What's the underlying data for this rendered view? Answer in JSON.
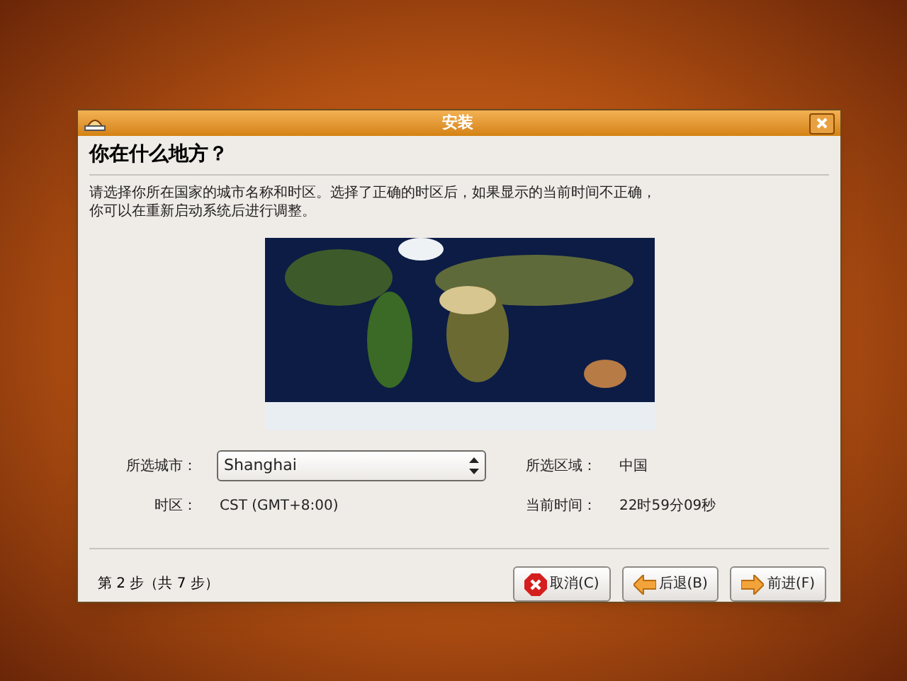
{
  "window": {
    "title": "安装"
  },
  "heading": "你在什么地方？",
  "description": "请选择你所在国家的城市名称和时区。选择了正确的时区后，如果显示的当前时间不正确，你可以在重新启动系统后进行调整。",
  "fields": [
    {
      "label": "所选城市：",
      "kind": "dropdown",
      "value": "Shanghai"
    },
    {
      "label": "所选区域：",
      "kind": "text",
      "value": "中国"
    },
    {
      "label": "时区：",
      "kind": "text",
      "value": "CST (GMT+8:00)"
    },
    {
      "label": "当前时间：",
      "kind": "text",
      "value": "22时59分09秒"
    }
  ],
  "step": "第 2 步（共 7 步）",
  "buttons": [
    {
      "label": "取消(C)",
      "kind": "cancel"
    },
    {
      "label": "后退(B)",
      "kind": "back"
    },
    {
      "label": "前进(F)",
      "kind": "forward"
    }
  ]
}
